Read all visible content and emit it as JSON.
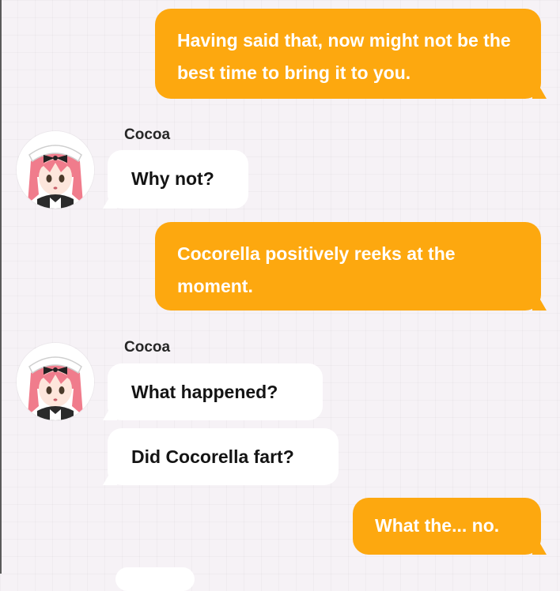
{
  "conversation": {
    "messages": [
      {
        "side": "outgoing",
        "text": "Having said that, now might not be the best time to bring it to you."
      },
      {
        "side": "incoming",
        "sender": "Cocoa",
        "texts": [
          "Why not?"
        ]
      },
      {
        "side": "outgoing",
        "text": "Cocorella positively reeks at the moment."
      },
      {
        "side": "incoming",
        "sender": "Cocoa",
        "texts": [
          "What happened?",
          "Did Cocorella fart?"
        ]
      },
      {
        "side": "outgoing",
        "text": "What the... no."
      }
    ]
  },
  "theme": {
    "outgoing_bubble_color": "#fda80f",
    "incoming_bubble_color": "#ffffff",
    "background_color": "#f6f2f6",
    "avatar_hair_color": "#f07c8c"
  },
  "icons": {
    "avatar": "cocoa-avatar-icon"
  }
}
